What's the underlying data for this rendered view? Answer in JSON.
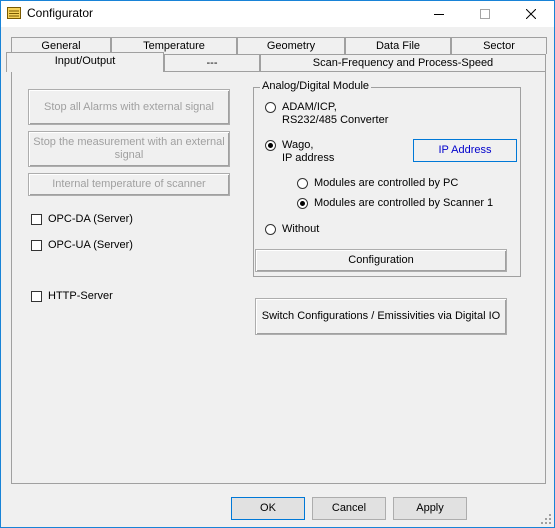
{
  "window": {
    "title": "Configurator"
  },
  "tabs_back": [
    "General",
    "Temperature",
    "Geometry",
    "Data File",
    "Sector"
  ],
  "tabs_front": [
    "Input/Output",
    "---",
    "Scan-Frequency and Process-Speed"
  ],
  "left": {
    "btn_stop_alarms": "Stop all Alarms with external signal",
    "btn_stop_measurement": "Stop the measurement with an external signal",
    "btn_internal_temp": "Internal temperature of scanner",
    "chk_opc_da": "OPC-DA (Server)",
    "chk_opc_ua": "OPC-UA (Server)",
    "chk_http": "HTTP-Server"
  },
  "module": {
    "group_label": "Analog/Digital Module",
    "radio_adam_line1": "ADAM/ICP,",
    "radio_adam_line2": "RS232/485 Converter",
    "radio_wago_line1": "Wago,",
    "radio_wago_line2": "IP address",
    "btn_ip": "IP Address",
    "radio_pc": "Modules are controlled by PC",
    "radio_scanner": "Modules are controlled by Scanner 1",
    "radio_without": "Without",
    "btn_configuration": "Configuration",
    "btn_switch": "Switch Configurations / Emissivities via Digital IO"
  },
  "footer": {
    "ok": "OK",
    "cancel": "Cancel",
    "apply": "Apply"
  }
}
